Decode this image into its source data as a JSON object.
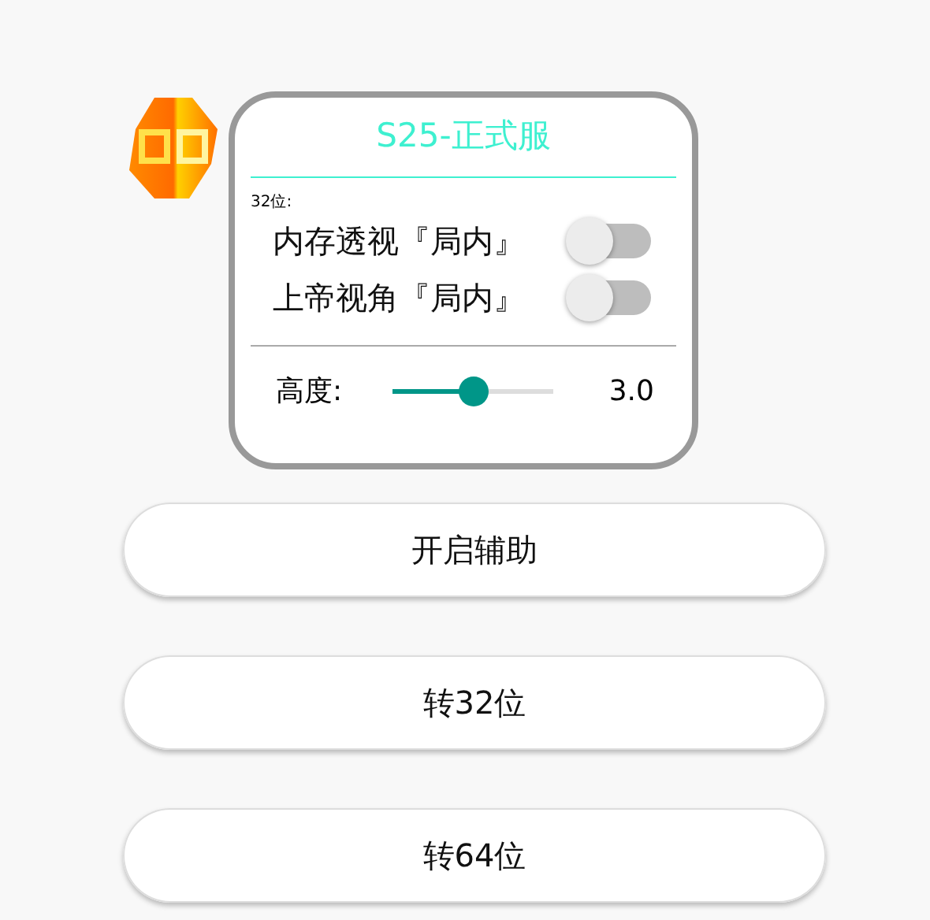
{
  "panel": {
    "title": "S25-正式服",
    "section_label": "32位:",
    "switches": [
      {
        "label": "内存透视『局内』",
        "on": false
      },
      {
        "label": "上帝视角『局内』",
        "on": false
      }
    ],
    "slider": {
      "label": "高度:",
      "level": 0.5,
      "reading": "3.0"
    }
  },
  "buttons": [
    "开启辅助",
    "转32位",
    "转64位"
  ]
}
